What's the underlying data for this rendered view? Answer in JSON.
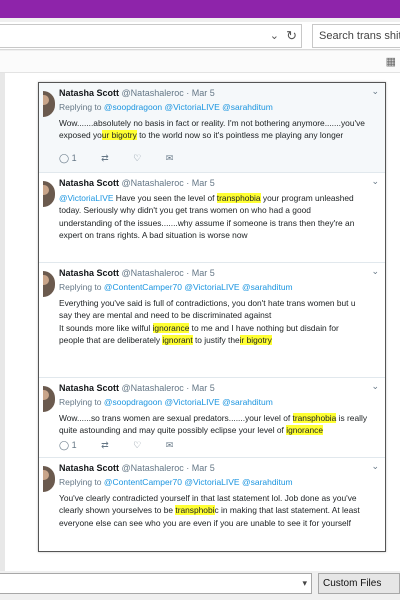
{
  "browser": {
    "search_placeholder": "Search trans shite"
  },
  "tweets": [
    {
      "name": "Natasha Scott",
      "handle": "@Natashaleroc · Mar 5",
      "replying_label": "Replying to",
      "replying_to": "@soopdragoon @VictoriaLIVE @sarahditum",
      "lines": [
        {
          "parts": [
            {
              "t": "Wow.......absolutely no basis in fact or reality. I'm not bothering anymore.......you've"
            }
          ]
        },
        {
          "parts": [
            {
              "t": "exposed yo"
            },
            {
              "t": "ur bigotry",
              "h": true
            },
            {
              "t": " to the world now so it's pointless me playing any longer"
            }
          ]
        }
      ],
      "reply_count": "1"
    },
    {
      "name": "Natasha Scott",
      "handle": "@Natashaleroc · Mar 5",
      "lines": [
        {
          "parts": [
            {
              "t": "@VictoriaLIVE",
              "l": true
            },
            {
              "t": " Have you seen the level of "
            },
            {
              "t": "transphobia",
              "h": true
            },
            {
              "t": " your program unleashed"
            }
          ]
        },
        {
          "parts": [
            {
              "t": "today. Seriously why didn't you get trans women on who had a good"
            }
          ]
        },
        {
          "parts": [
            {
              "t": "understanding of the issues.......why assume if someone is trans then they're an"
            }
          ]
        },
        {
          "parts": [
            {
              "t": "expert on trans rights. A bad situation is worse now"
            }
          ]
        }
      ]
    },
    {
      "name": "Natasha Scott",
      "handle": "@Natashaleroc · Mar 5",
      "replying_label": "Replying to",
      "replying_to": "@ContentCamper70 @VictoriaLIVE @sarahditum",
      "lines": [
        {
          "parts": [
            {
              "t": "Everything you've said is full of contradictions, you don't hate trans women but u"
            }
          ]
        },
        {
          "parts": [
            {
              "t": "say they are mental and need to be discriminated against"
            }
          ]
        },
        {
          "parts": [
            {
              "t": "It sounds more like wilful "
            },
            {
              "t": "ignorance",
              "h": true
            },
            {
              "t": " to me and I have nothing but disdain for"
            }
          ]
        },
        {
          "parts": [
            {
              "t": "people that are deliberately "
            },
            {
              "t": "ignorant",
              "h": true
            },
            {
              "t": " to justify the"
            },
            {
              "t": "ir bigotry",
              "h": true
            }
          ]
        }
      ]
    },
    {
      "name": "Natasha Scott",
      "handle": "@Natashaleroc · Mar 5",
      "replying_label": "Replying to",
      "replying_to": "@soopdragoon @VictoriaLIVE @sarahditum",
      "lines": [
        {
          "parts": [
            {
              "t": "Wow......so trans women are sexual predators.......your level of "
            },
            {
              "t": "transphobia",
              "h": true
            },
            {
              "t": " is really"
            }
          ]
        },
        {
          "parts": [
            {
              "t": "quite astounding and may quite possibly eclipse your level of "
            },
            {
              "t": "ignorance",
              "h": true
            }
          ]
        }
      ],
      "reply_count": "1"
    },
    {
      "name": "Natasha Scott",
      "handle": "@Natashaleroc · Mar 5",
      "replying_label": "Replying to",
      "replying_to": "@ContentCamper70 @VictoriaLIVE @sarahditum",
      "lines": [
        {
          "parts": [
            {
              "t": "You've clearly contradicted yourself in that last statement lol. Job done as you've"
            }
          ]
        },
        {
          "parts": [
            {
              "t": "clearly shown yourselves to be "
            },
            {
              "t": "transphobi",
              "h": true
            },
            {
              "t": "c in making that last statement. At least"
            }
          ]
        },
        {
          "parts": [
            {
              "t": "everyone else can see who you are even if you are unable to see it for yourself"
            }
          ]
        }
      ]
    }
  ],
  "bottom": {
    "custom_files_label": "Custom Files"
  },
  "colors": {
    "titlebar": "#8e24aa",
    "highlight": "#ffff33",
    "link": "#1b95e0"
  },
  "icons": {
    "reply": "reply-icon",
    "retweet": "retweet-icon",
    "like": "like-icon",
    "dm": "envelope-icon"
  }
}
